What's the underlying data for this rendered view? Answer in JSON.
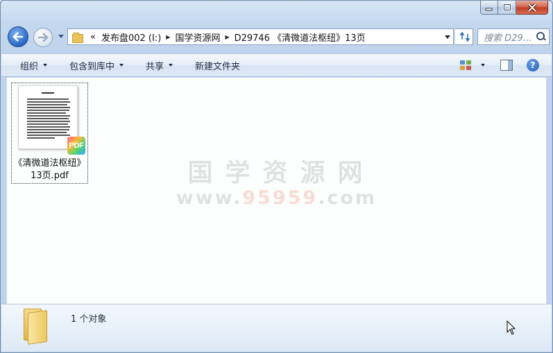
{
  "window": {
    "caption_buttons": {
      "minimize": "minimize",
      "maximize": "maximize",
      "close": "close"
    }
  },
  "address_bar": {
    "overflow": "«",
    "crumbs": [
      "发布盘002 (I:)",
      "国学资源网",
      "D29746 《清微道法枢纽》13页"
    ],
    "refresh_icon": "refresh-icon"
  },
  "search": {
    "placeholder": "搜索 D29..."
  },
  "toolbar": {
    "organize": "组织",
    "include_in_library": "包含到库中",
    "share": "共享",
    "new_folder": "新建文件夹",
    "help": "?"
  },
  "files": [
    {
      "name": "《清微道法枢纽》13页.pdf",
      "badge": "PDF"
    }
  ],
  "watermark": {
    "cn": "国学资源网",
    "url_prefix": "www.",
    "url_number": "95959",
    "url_suffix": ".com"
  },
  "details": {
    "status": "1 个对象"
  },
  "colors": {
    "accent": "#2a67c4",
    "close_button": "#c0391f"
  }
}
